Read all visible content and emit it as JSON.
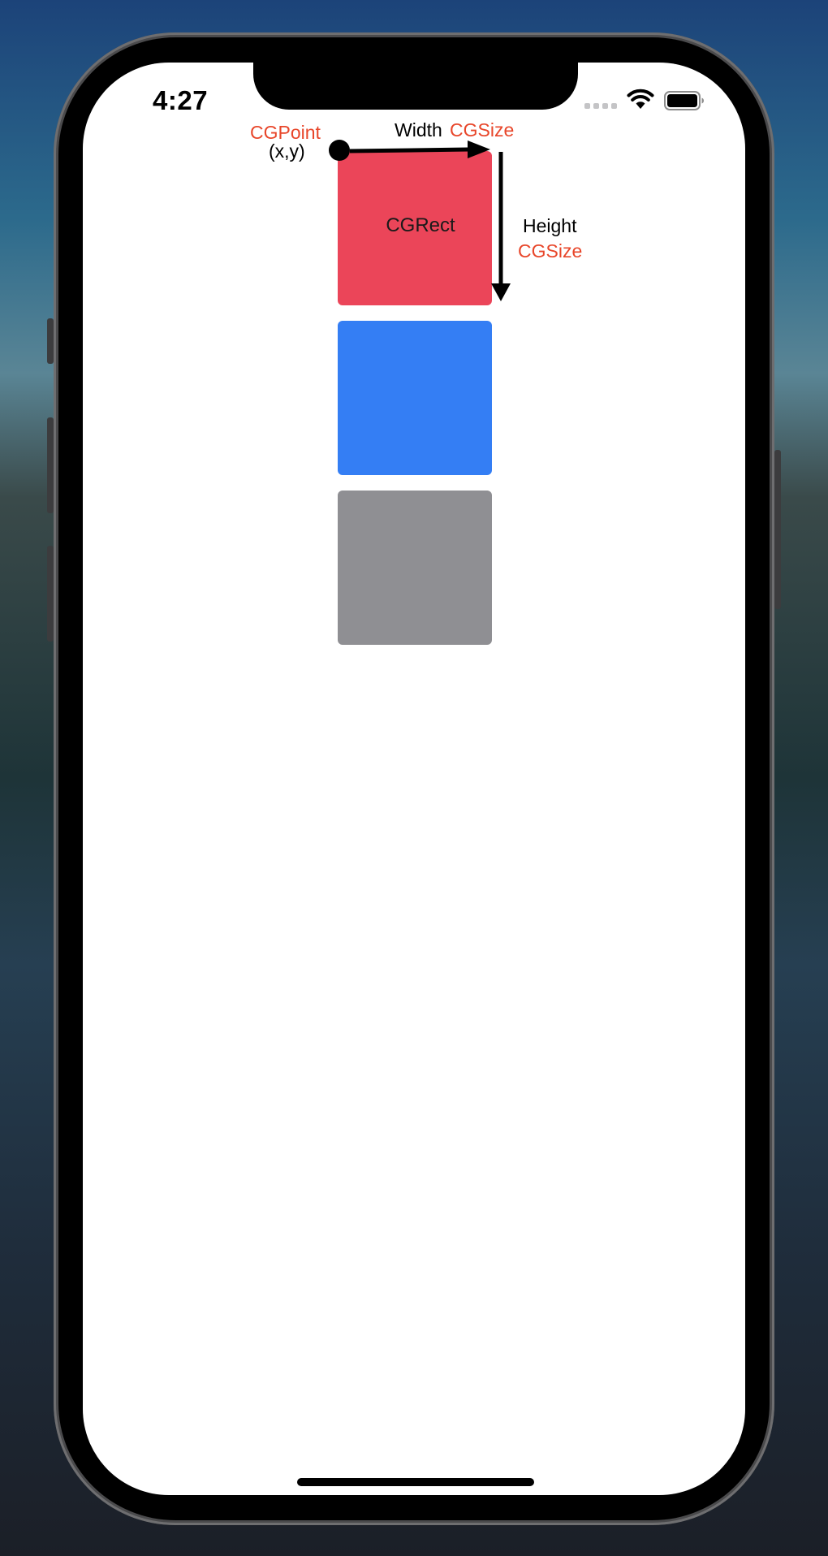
{
  "status_bar": {
    "time": "4:27"
  },
  "diagram": {
    "point_type": "CGPoint",
    "point_coords": "(x,y)",
    "width_label": "Width",
    "width_type": "CGSize",
    "height_label": "Height",
    "height_type": "CGSize",
    "rect_label": "CGRect"
  },
  "colors": {
    "rect_red": "#eb4559",
    "rect_blue": "#347ef4",
    "rect_gray": "#8f8f93",
    "type_text": "#e8462a"
  },
  "icons": {
    "wifi": "wifi-icon",
    "battery": "battery-icon",
    "signal": "signal-dots-icon"
  }
}
